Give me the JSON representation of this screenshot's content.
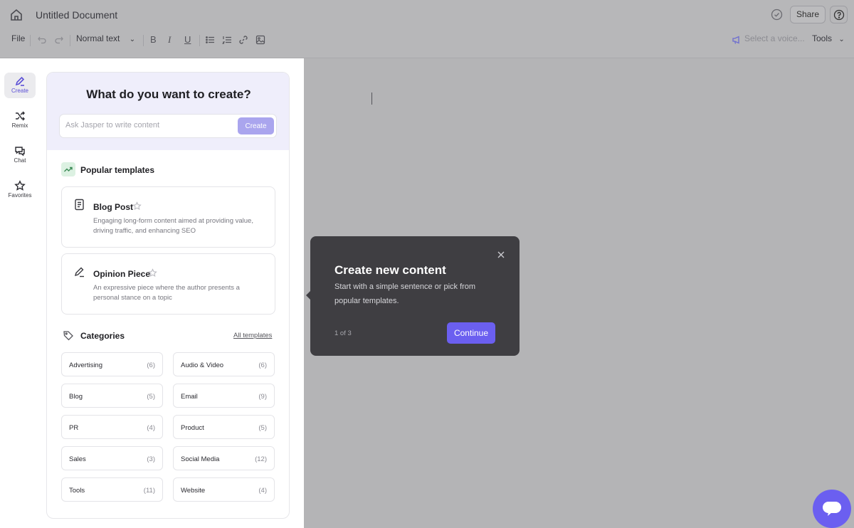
{
  "header": {
    "doc_title": "Untitled Document",
    "share_label": "Share"
  },
  "toolbar": {
    "file_label": "File",
    "style_value": "Normal text",
    "voice_placeholder": "Select a voice...",
    "tools_label": "Tools"
  },
  "rail": {
    "items": [
      {
        "label": "Create",
        "icon": "pen-icon",
        "active": true
      },
      {
        "label": "Remix",
        "icon": "shuffle-icon"
      },
      {
        "label": "Chat",
        "icon": "chat-icon"
      },
      {
        "label": "Favorites",
        "icon": "star-icon"
      }
    ]
  },
  "panel": {
    "title": "What do you want to create?",
    "ask_placeholder": "Ask Jasper to write content",
    "create_label": "Create",
    "popular_title": "Popular templates",
    "templates": [
      {
        "name": "Blog Post",
        "desc": "Engaging long-form content aimed at providing value, driving traffic, and enhancing SEO",
        "icon": "document-icon"
      },
      {
        "name": "Opinion Piece",
        "desc": "An expressive piece where the author presents a personal stance on a topic",
        "icon": "pen-icon"
      }
    ],
    "categories_title": "Categories",
    "all_templates_label": "All templates",
    "categories": [
      {
        "name": "Advertising",
        "count": "(6)"
      },
      {
        "name": "Audio & Video",
        "count": "(6)"
      },
      {
        "name": "Blog",
        "count": "(5)"
      },
      {
        "name": "Email",
        "count": "(9)"
      },
      {
        "name": "PR",
        "count": "(4)"
      },
      {
        "name": "Product",
        "count": "(5)"
      },
      {
        "name": "Sales",
        "count": "(3)"
      },
      {
        "name": "Social Media",
        "count": "(12)"
      },
      {
        "name": "Tools",
        "count": "(11)"
      },
      {
        "name": "Website",
        "count": "(4)"
      }
    ]
  },
  "tooltip": {
    "title": "Create new content",
    "body": "Start with a simple sentence or pick from popular templates.",
    "step": "1 of 3",
    "continue_label": "Continue"
  },
  "colors": {
    "accent": "#6b5ff0",
    "create_button": "#aaa5ee",
    "panel_header": "#efeefb",
    "tooltip_bg": "#3f3e42",
    "overlay": "#b4b4b6"
  }
}
